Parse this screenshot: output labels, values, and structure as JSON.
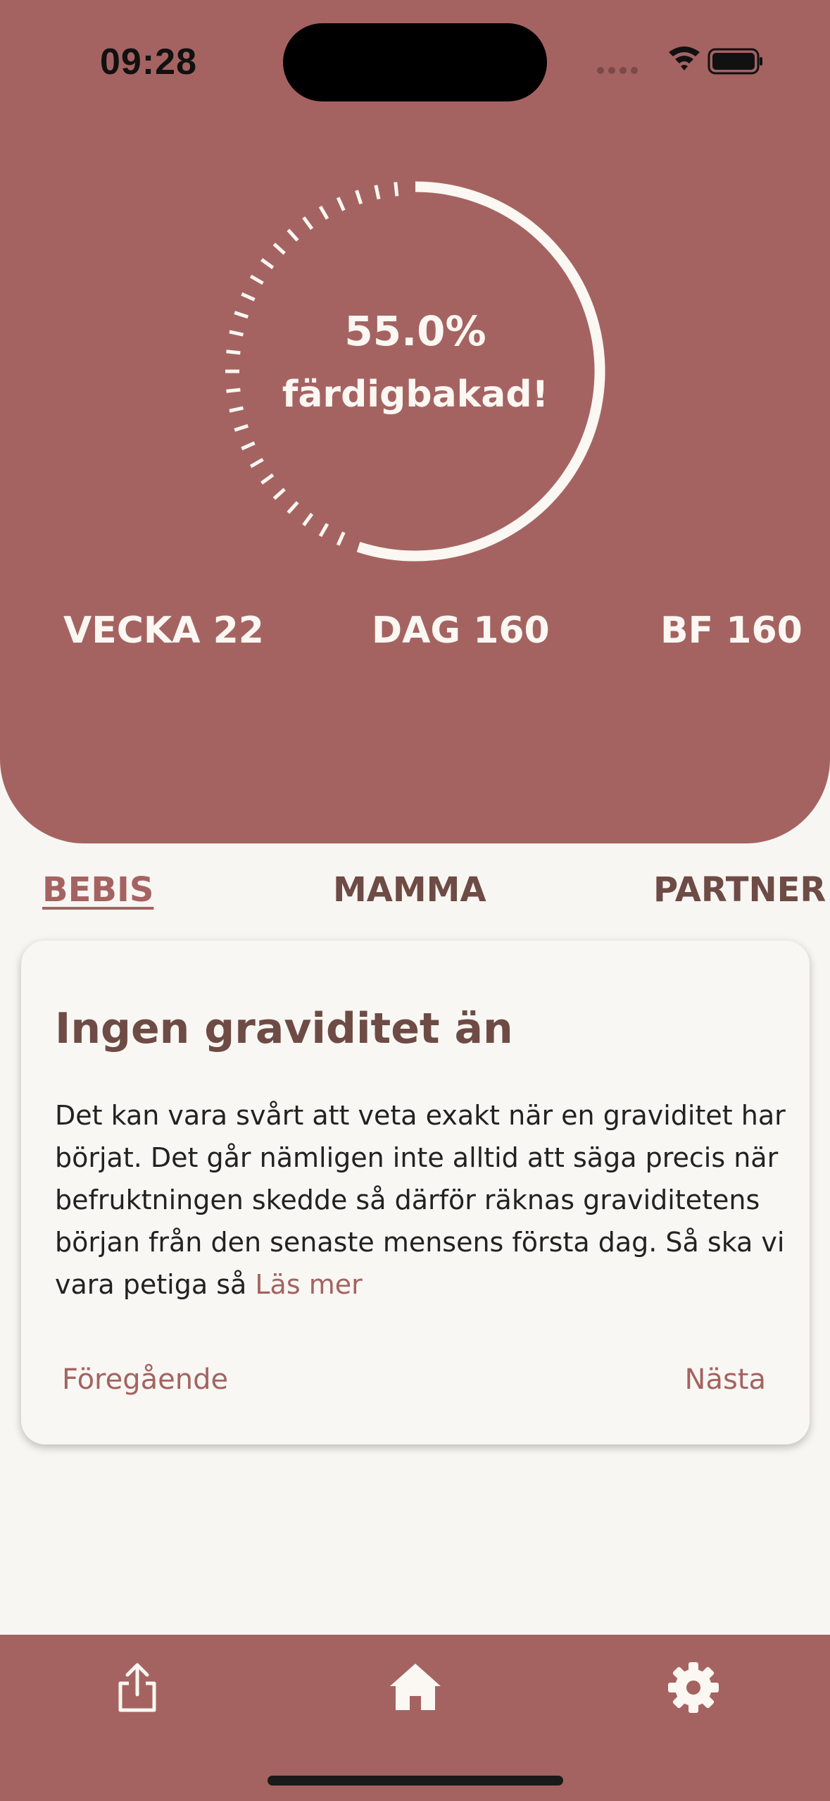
{
  "status_bar": {
    "time": "09:28"
  },
  "progress": {
    "value": 0.55,
    "percent_label": "55.0%",
    "subtitle": "färdigbakad!"
  },
  "counters": {
    "week": "VECKA 22",
    "day": "DAG 160",
    "bf": "BF 160"
  },
  "tabs": [
    {
      "label": "BEBIS",
      "active": true
    },
    {
      "label": "MAMMA",
      "active": false
    },
    {
      "label": "PARTNER",
      "active": false
    }
  ],
  "card": {
    "title": "Ingen graviditet än",
    "body": "Det kan vara svårt att veta exakt när en graviditet har börjat. Det går nämligen inte alltid att säga precis när befruktningen skedde så därför räknas graviditetens början från den senaste mensens första dag. Så ska vi vara petiga så ",
    "read_more": "Läs mer",
    "prev": "Föregående",
    "next": "Nästa"
  },
  "tab_bar": {
    "icons": [
      "share-icon",
      "home-icon",
      "gear-icon"
    ]
  },
  "colors": {
    "accent": "#a46361",
    "background": "#f8f6f2",
    "heading": "#6e4b45",
    "ring": "#fbf7f2"
  }
}
